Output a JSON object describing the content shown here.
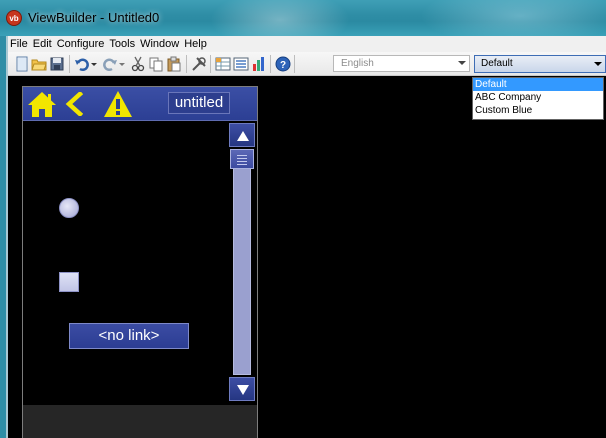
{
  "window": {
    "title": "ViewBuilder - Untitled0",
    "logo_text": "vb"
  },
  "menu": [
    "File",
    "Edit",
    "Configure",
    "Tools",
    "Window",
    "Help"
  ],
  "toolbar": {
    "icons": [
      "new-file-icon",
      "open-folder-icon",
      "save-icon",
      "undo-icon",
      "redo-icon",
      "cut-icon",
      "copy-icon",
      "paste-icon",
      "tool-icon",
      "table-icon",
      "list-icon",
      "bar-chart-icon",
      "help-icon"
    ],
    "language_value": "English",
    "theme_value": "Default"
  },
  "theme_dropdown": {
    "options": [
      "Default",
      "ABC Company",
      "Custom Blue"
    ],
    "selected": "Default"
  },
  "device": {
    "header_label": "untitled",
    "link_button_label": "<no link>",
    "accent_color": "#2c3f94",
    "icon_color": "#f2e600"
  }
}
